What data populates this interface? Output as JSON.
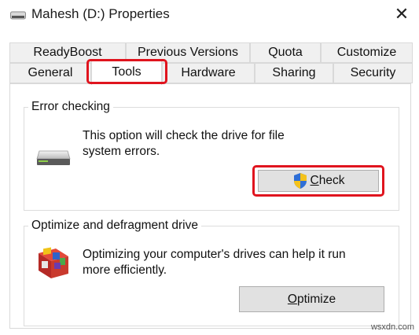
{
  "window": {
    "title": "Mahesh (D:) Properties",
    "close_glyph": "✕"
  },
  "tabs": {
    "row1": [
      "ReadyBoost",
      "Previous Versions",
      "Quota",
      "Customize"
    ],
    "row2": [
      "General",
      "Tools",
      "Hardware",
      "Sharing",
      "Security"
    ],
    "active": "Tools"
  },
  "error_checking": {
    "title": "Error checking",
    "description_line1": "This option will check the drive for file",
    "description_line2": "system errors.",
    "button_label": "Check",
    "button_mnemonic": "C",
    "button_rest": "heck",
    "icon": "drive-icon",
    "button_icon": "uac-shield-icon"
  },
  "optimize": {
    "title": "Optimize and defragment drive",
    "description_line1": "Optimizing your computer's drives can help it run",
    "description_line2": "more efficiently.",
    "button_mnemonic": "O",
    "button_rest": "ptimize",
    "icon": "defrag-icon"
  },
  "highlight_color": "#e0141e",
  "watermark": "wsxdn.com"
}
